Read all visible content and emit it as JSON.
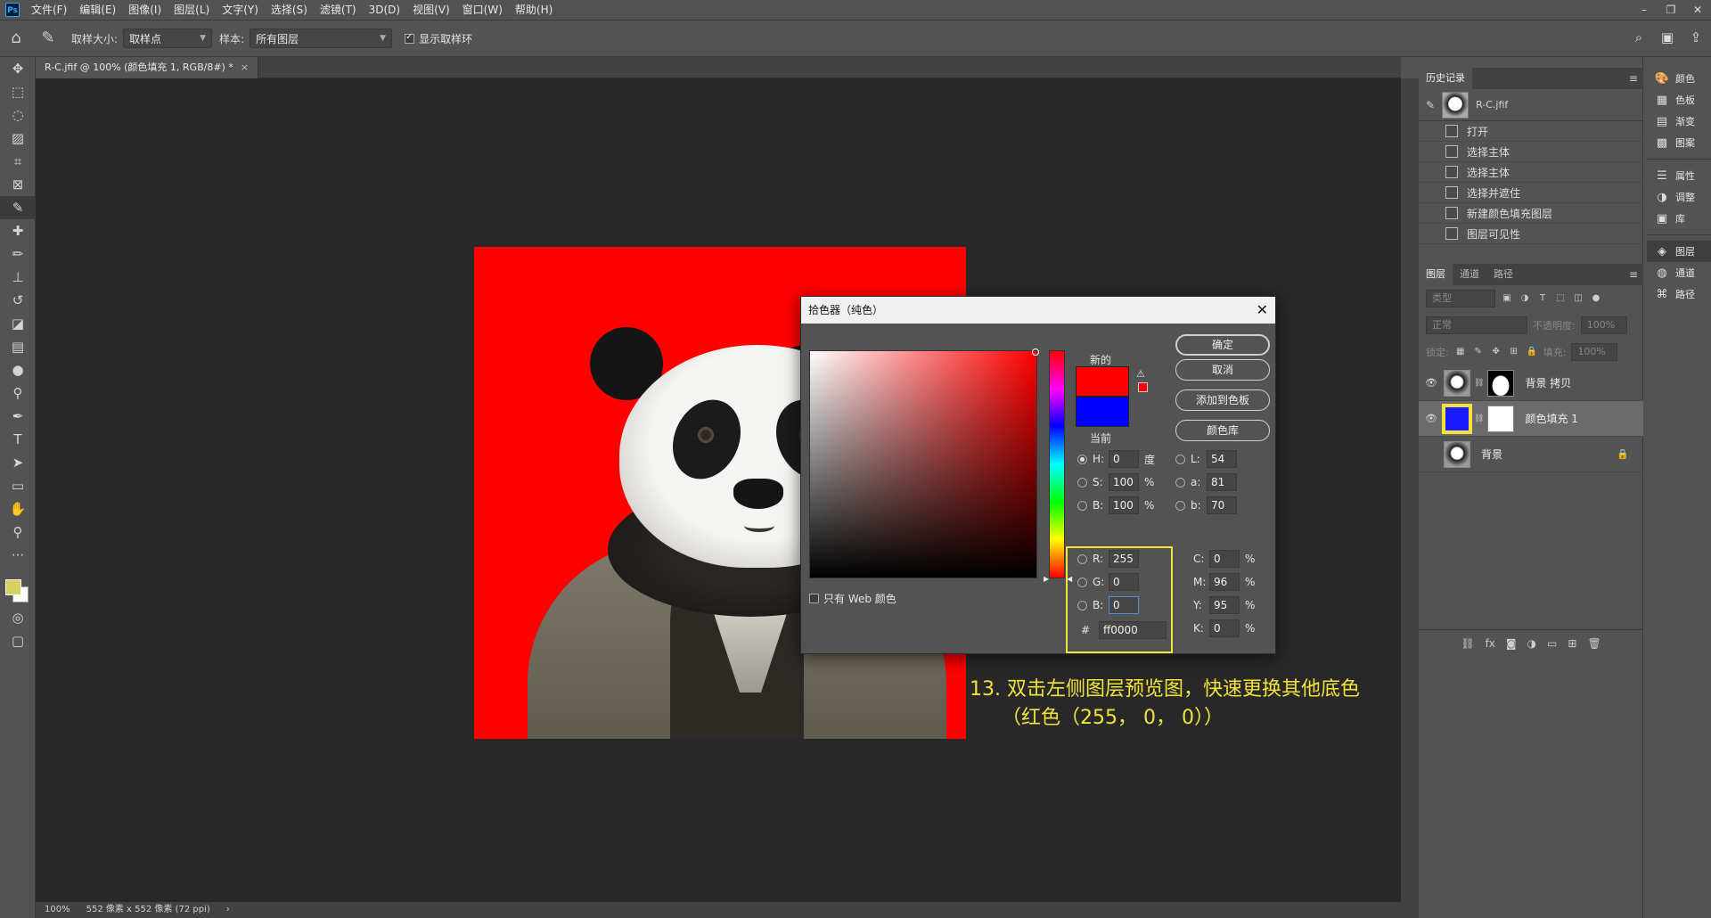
{
  "menu": [
    "文件(F)",
    "编辑(E)",
    "图像(I)",
    "图层(L)",
    "文字(Y)",
    "选择(S)",
    "滤镜(T)",
    "3D(D)",
    "视图(V)",
    "窗口(W)",
    "帮助(H)"
  ],
  "app_logo": "Ps",
  "options": {
    "sample_size_label": "取样大小:",
    "sample_size_value": "取样点",
    "sample_label": "样本:",
    "sample_value": "所有图层",
    "show_ring_label": "显示取样环"
  },
  "document": {
    "tab_title": "R-C.jfif @ 100% (颜色填充 1, RGB/8#) *",
    "zoom": "100%",
    "dimensions": "552 像素 x 552 像素 (72 ppi)"
  },
  "annotation": {
    "line1": "13. 双击左侧图层预览图，快速更换其他底色",
    "line2": "（红色（255， 0， 0））"
  },
  "picker": {
    "title": "拾色器（纯色）",
    "new_label": "新的",
    "current_label": "当前",
    "new_color": "#ff0000",
    "current_color": "#0000ff",
    "buttons": {
      "ok": "确定",
      "cancel": "取消",
      "add_swatch": "添加到色板",
      "libraries": "颜色库"
    },
    "web_only_label": "只有 Web 颜色",
    "hsb": {
      "h_label": "H:",
      "h": "0",
      "h_unit": "度",
      "s_label": "S:",
      "s": "100",
      "s_unit": "%",
      "b_label": "B:",
      "b": "100",
      "b_unit": "%"
    },
    "lab": {
      "l_label": "L:",
      "l": "54",
      "a_label": "a:",
      "a": "81",
      "b_label": "b:",
      "b": "70"
    },
    "rgb": {
      "r_label": "R:",
      "r": "255",
      "g_label": "G:",
      "g": "0",
      "b_label": "B:",
      "b": "0"
    },
    "cmyk": {
      "c_label": "C:",
      "c": "0",
      "m_label": "M:",
      "m": "96",
      "y_label": "Y:",
      "y": "95",
      "k_label": "K:",
      "k": "0",
      "unit": "%"
    },
    "hex_label": "#",
    "hex": "ff0000"
  },
  "history": {
    "tab": "历史记录",
    "snapshot": "R-C.jfif",
    "items": [
      "打开",
      "选择主体",
      "选择主体",
      "选择并遮住",
      "新建颜色填充图层",
      "图层可见性"
    ]
  },
  "layers": {
    "tabs": [
      "图层",
      "通道",
      "路径"
    ],
    "filter_placeholder": "类型",
    "blend_mode": "正常",
    "opacity_label": "不透明度:",
    "opacity": "100%",
    "lock_label": "锁定:",
    "fill_label": "填充:",
    "fill": "100%",
    "rows": [
      {
        "name": "背景 拷贝"
      },
      {
        "name": "颜色填充 1"
      },
      {
        "name": "背景"
      }
    ]
  },
  "dock": {
    "group1": [
      "颜色",
      "色板",
      "渐变",
      "图案"
    ],
    "group2": [
      "属性",
      "调整",
      "库"
    ],
    "group3": [
      "图层",
      "通道",
      "路径"
    ]
  }
}
